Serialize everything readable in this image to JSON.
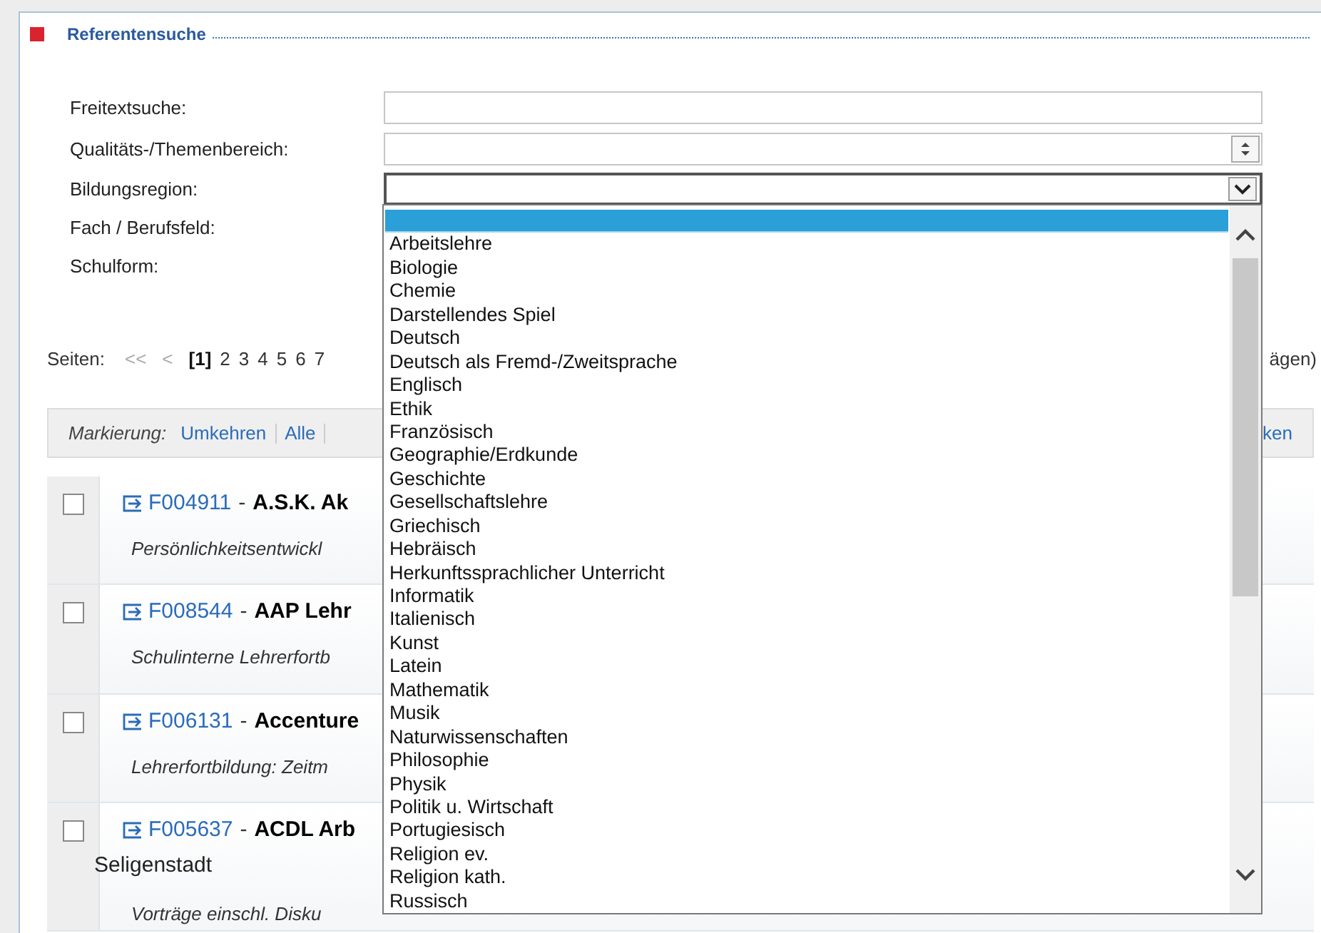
{
  "panel": {
    "title": "Referentensuche"
  },
  "form": {
    "fields": [
      {
        "label": "Freitextsuche:",
        "kind": "text"
      },
      {
        "label": "Qualitäts-/Themenbereich:",
        "kind": "spinner"
      },
      {
        "label": "Bildungsregion:",
        "kind": "select",
        "focused": true
      },
      {
        "label": "Fach / Berufsfeld:",
        "kind": "hidden"
      },
      {
        "label": "Schulform:",
        "kind": "hidden"
      }
    ]
  },
  "dropdown": {
    "options": [
      {
        "selected": true
      },
      {
        "label": "Arbeitslehre",
        "selected": false
      },
      {
        "label": "Biologie",
        "selected": false
      },
      {
        "label": "Chemie",
        "selected": false
      },
      {
        "label": "Darstellendes Spiel",
        "selected": false
      },
      {
        "label": "Deutsch",
        "selected": false
      },
      {
        "label": "Deutsch als Fremd-/Zweitsprache",
        "selected": false
      },
      {
        "label": "Englisch",
        "selected": false
      },
      {
        "label": "Ethik",
        "selected": false
      },
      {
        "label": "Französisch",
        "selected": false
      },
      {
        "label": "Geographie/Erdkunde",
        "selected": false
      },
      {
        "label": "Geschichte",
        "selected": false
      },
      {
        "label": "Gesellschaftslehre",
        "selected": false
      },
      {
        "label": "Griechisch",
        "selected": false
      },
      {
        "label": "Hebräisch",
        "selected": false
      },
      {
        "label": "Herkunftssprachlicher Unterricht",
        "selected": false
      },
      {
        "label": "Informatik",
        "selected": false
      },
      {
        "label": "Italienisch",
        "selected": false
      },
      {
        "label": "Kunst",
        "selected": false
      },
      {
        "label": "Latein",
        "selected": false
      },
      {
        "label": "Mathematik",
        "selected": false
      },
      {
        "label": "Musik",
        "selected": false
      },
      {
        "label": "Naturwissenschaften",
        "selected": false
      },
      {
        "label": "Philosophie",
        "selected": false
      },
      {
        "label": "Physik",
        "selected": false
      },
      {
        "label": "Politik u. Wirtschaft",
        "selected": false
      },
      {
        "label": "Portugiesisch",
        "selected": false
      },
      {
        "label": "Religion ev.",
        "selected": false
      },
      {
        "label": "Religion kath.",
        "selected": false
      },
      {
        "label": "Russisch",
        "selected": false
      }
    ]
  },
  "pagination": {
    "label": "Seiten:",
    "first": "<<",
    "prev": "<",
    "pages": [
      {
        "label": "[1]",
        "selected": true
      },
      {
        "label": "2",
        "selected": false
      },
      {
        "label": "3",
        "selected": false
      },
      {
        "label": "4",
        "selected": false
      },
      {
        "label": "5",
        "selected": false
      },
      {
        "label": "6",
        "selected": false
      },
      {
        "label": "7",
        "selected": false
      }
    ],
    "trailing": "ägen)"
  },
  "toolbar": {
    "label": "Markierung:",
    "links": [
      "Umkehren",
      "Alle"
    ],
    "trailing": "ken"
  },
  "results": [
    {
      "checked": false,
      "id": "F004911",
      "separator": "-",
      "title": "A.S.K. Ak",
      "description": "Persönlichkeitsentwickl"
    },
    {
      "checked": false,
      "id": "F008544",
      "separator": "-",
      "title": "AAP Lehr",
      "description": "Schulinterne Lehrerfortb"
    },
    {
      "checked": false,
      "id": "F006131",
      "separator": "-",
      "title": "Accenture",
      "description": "Lehrerfortbildung: Zeitm"
    },
    {
      "checked": false,
      "id": "F005637",
      "separator": "-",
      "title": "ACDL Arb",
      "title_line_2": "Seligenstadt",
      "description": "Vorträge einschl. Disku"
    }
  ]
}
